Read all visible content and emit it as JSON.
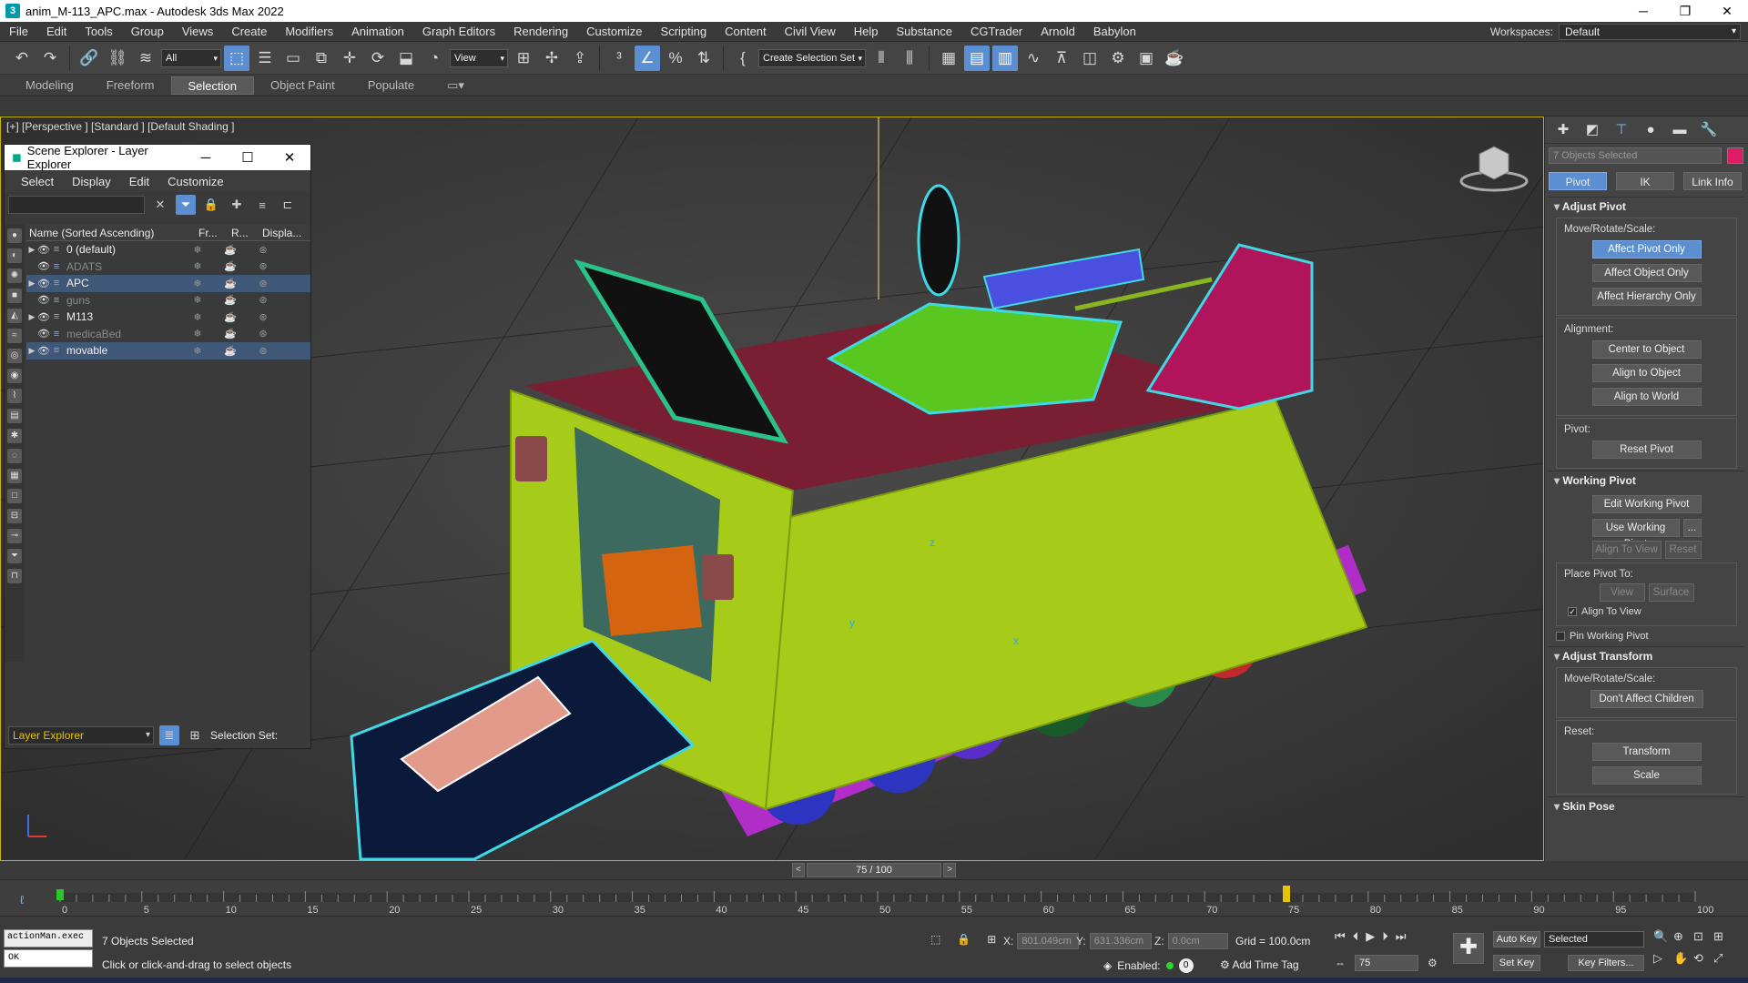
{
  "window": {
    "title": "anim_M-113_APC.max - Autodesk 3ds Max 2022",
    "icon": "3ds-max-icon",
    "minimize": "─",
    "maximize": "❐",
    "close": "✕"
  },
  "menubar": {
    "items": [
      "File",
      "Edit",
      "Tools",
      "Group",
      "Views",
      "Create",
      "Modifiers",
      "Animation",
      "Graph Editors",
      "Rendering",
      "Customize",
      "Scripting",
      "Content",
      "Civil View",
      "Help",
      "Substance",
      "CGTrader",
      "Arnold",
      "Babylon"
    ],
    "workspace_label": "Workspaces:",
    "workspace_value": "Default"
  },
  "toolbar": {
    "filter_value": "All",
    "refcoord_value": "View",
    "selection_set_placeholder": "Create Selection Set",
    "icons": [
      "undo-icon",
      "redo-icon",
      "link-icon",
      "unlink-icon",
      "bind-spacewarp-icon",
      "select-object-icon",
      "select-by-name-icon",
      "rect-selection-icon",
      "window-crossing-icon",
      "move-icon",
      "rotate-icon",
      "scale-icon",
      "place-icon",
      "snap-3d-icon",
      "angle-snap-icon",
      "percent-snap-icon",
      "spinner-snap-icon",
      "edit-named-selection-icon",
      "mirror-icon",
      "align-icon",
      "scene-explorer-icon",
      "layer-explorer-icon",
      "toggle-ribbon-icon",
      "curve-editor-icon",
      "schematic-view-icon",
      "material-editor-icon",
      "render-setup-icon",
      "rendered-frame-icon",
      "render-icon"
    ]
  },
  "ribbon": {
    "tabs": [
      "Modeling",
      "Freeform",
      "Selection",
      "Object Paint",
      "Populate"
    ],
    "active": "Selection"
  },
  "viewport": {
    "label": "[+] [Perspective ] [Standard ] [Default Shading ]",
    "axis_z": "z",
    "axis_y": "y",
    "axis_x": "x"
  },
  "scene_explorer": {
    "title": "Scene Explorer - Layer Explorer",
    "minimize": "─",
    "maximize": "☐",
    "close": "✕",
    "menu": [
      "Select",
      "Display",
      "Edit",
      "Customize"
    ],
    "search_placeholder": "",
    "columns": [
      "Name (Sorted Ascending)",
      "Fr...",
      "R...",
      "Displa..."
    ],
    "rows": [
      {
        "name": "0 (default)",
        "expandable": true,
        "dim": false,
        "selected": false,
        "freeze": "❄",
        "render": "☕",
        "display": "⊛"
      },
      {
        "name": "ADATS",
        "expandable": false,
        "dim": true,
        "selected": false,
        "freeze": "❄",
        "render": "☕",
        "display": "⊛"
      },
      {
        "name": "APC",
        "expandable": true,
        "dim": false,
        "selected": true,
        "freeze": "❄",
        "render": "☕",
        "display": "⊛"
      },
      {
        "name": "guns",
        "expandable": false,
        "dim": true,
        "selected": false,
        "freeze": "❄",
        "render": "☕",
        "display": "⊛"
      },
      {
        "name": "M113",
        "expandable": true,
        "dim": false,
        "selected": false,
        "freeze": "❄",
        "render": "☕",
        "display": "⊛"
      },
      {
        "name": "medicaBed",
        "expandable": false,
        "dim": true,
        "selected": false,
        "freeze": "❄",
        "render": "☕",
        "display": "⊛"
      },
      {
        "name": "movable",
        "expandable": true,
        "dim": false,
        "selected": true,
        "freeze": "❄",
        "render": "☕",
        "display": "⊛"
      }
    ],
    "footer_dropdown": "Layer Explorer",
    "selection_set_label": "Selection Set:"
  },
  "command_panel": {
    "name_field": "7 Objects Selected",
    "color_swatch": "#e01b66",
    "subtabs": [
      "Pivot",
      "IK",
      "Link Info"
    ],
    "active_subtab": "Pivot",
    "adjust_pivot": {
      "title": "Adjust Pivot",
      "move_label": "Move/Rotate/Scale:",
      "affect_pivot": "Affect Pivot Only",
      "affect_object": "Affect Object Only",
      "affect_hierarchy": "Affect Hierarchy Only",
      "alignment_label": "Alignment:",
      "center": "Center to Object",
      "align_object": "Align to Object",
      "align_world": "Align to World",
      "pivot_label": "Pivot:",
      "reset_pivot": "Reset Pivot"
    },
    "working_pivot": {
      "title": "Working Pivot",
      "edit": "Edit Working Pivot",
      "use": "Use Working Pivot",
      "more": "...",
      "align_view": "Align To View",
      "reset": "Reset",
      "place_label": "Place Pivot To:",
      "view": "View",
      "surface": "Surface",
      "align_to_view_chk": "Align To View",
      "pin": "Pin Working Pivot"
    },
    "adjust_transform": {
      "title": "Adjust Transform",
      "move_label": "Move/Rotate/Scale:",
      "dont_affect": "Don't Affect Children",
      "reset_label": "Reset:",
      "transform": "Transform",
      "scale": "Scale"
    },
    "skin_pose": {
      "title": "Skin Pose"
    }
  },
  "timeline": {
    "frame_display": "75 / 100",
    "current_frame": 75,
    "total_frames": 100,
    "ticks": [
      "0",
      "5",
      "10",
      "15",
      "20",
      "25",
      "30",
      "35",
      "40",
      "45",
      "50",
      "55",
      "60",
      "65",
      "70",
      "75",
      "80",
      "85",
      "90",
      "95",
      "100"
    ]
  },
  "status": {
    "maxscript_input": "actionMan.exec",
    "maxscript_output": "OK",
    "selection": "7 Objects Selected",
    "prompt": "Click or click-and-drag to select objects",
    "x_label": "X:",
    "x_value": "801.049cm",
    "y_label": "Y:",
    "y_value": "631.336cm",
    "z_label": "Z:",
    "z_value": "0.0cm",
    "grid": "Grid = 100.0cm",
    "enabled_label": "Enabled:",
    "enabled_count": "0",
    "add_time_tag": "Add Time Tag",
    "frame_input": "75",
    "auto_key": "Auto Key",
    "set_key": "Set Key",
    "key_mode": "Selected",
    "key_filters": "Key Filters..."
  }
}
